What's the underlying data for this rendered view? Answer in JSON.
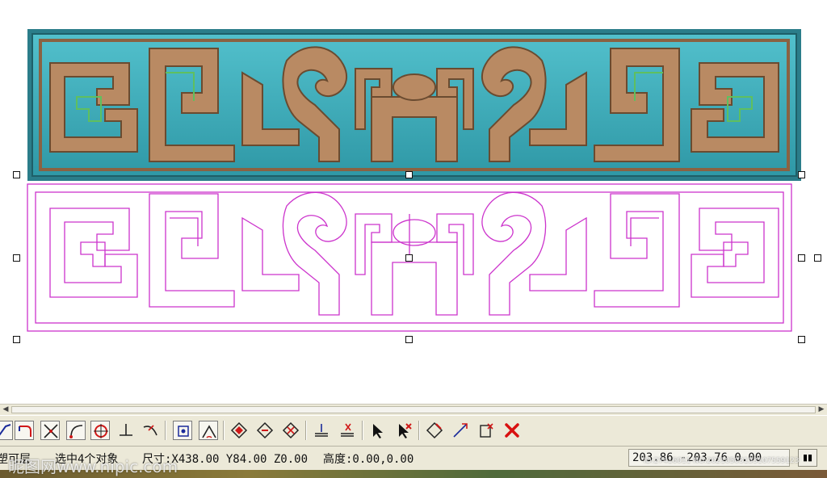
{
  "status": {
    "layer_text": "塑可层",
    "selection_text": "选中4个对象",
    "size_text": "尺寸:X438.00 Y84.00 Z0.00",
    "height_text": "高度:0.00,0.00",
    "coords_text": "203.86 -203.76 0.00"
  },
  "watermark": {
    "left_text": "昵图网www.nipic.com",
    "right_text": "ID:27416011 NO:20210503153107559123"
  },
  "toolbar": {
    "icons": [
      "extend-curve-icon",
      "corner-curve-icon",
      "intersect-lines-icon",
      "arc-curve-icon",
      "circle-node-icon",
      "perpendicular-icon",
      "trim-curve-icon",
      "snap-node-icon",
      "angle-tool-icon",
      "diamond-tool-1-icon",
      "diamond-tool-2-icon",
      "diamond-tool-3-icon",
      "layer-stack-icon",
      "layer-stack-2-icon",
      "select-arrow-icon",
      "deselect-arrow-icon",
      "node-edit-icon",
      "transform-icon",
      "cut-icon",
      "delete-icon"
    ]
  },
  "colors": {
    "relief_background": "#3aa7b4",
    "relief_carving": "#b98a63",
    "vector_outline": "#cc33cc",
    "delete_red": "#d81010"
  }
}
